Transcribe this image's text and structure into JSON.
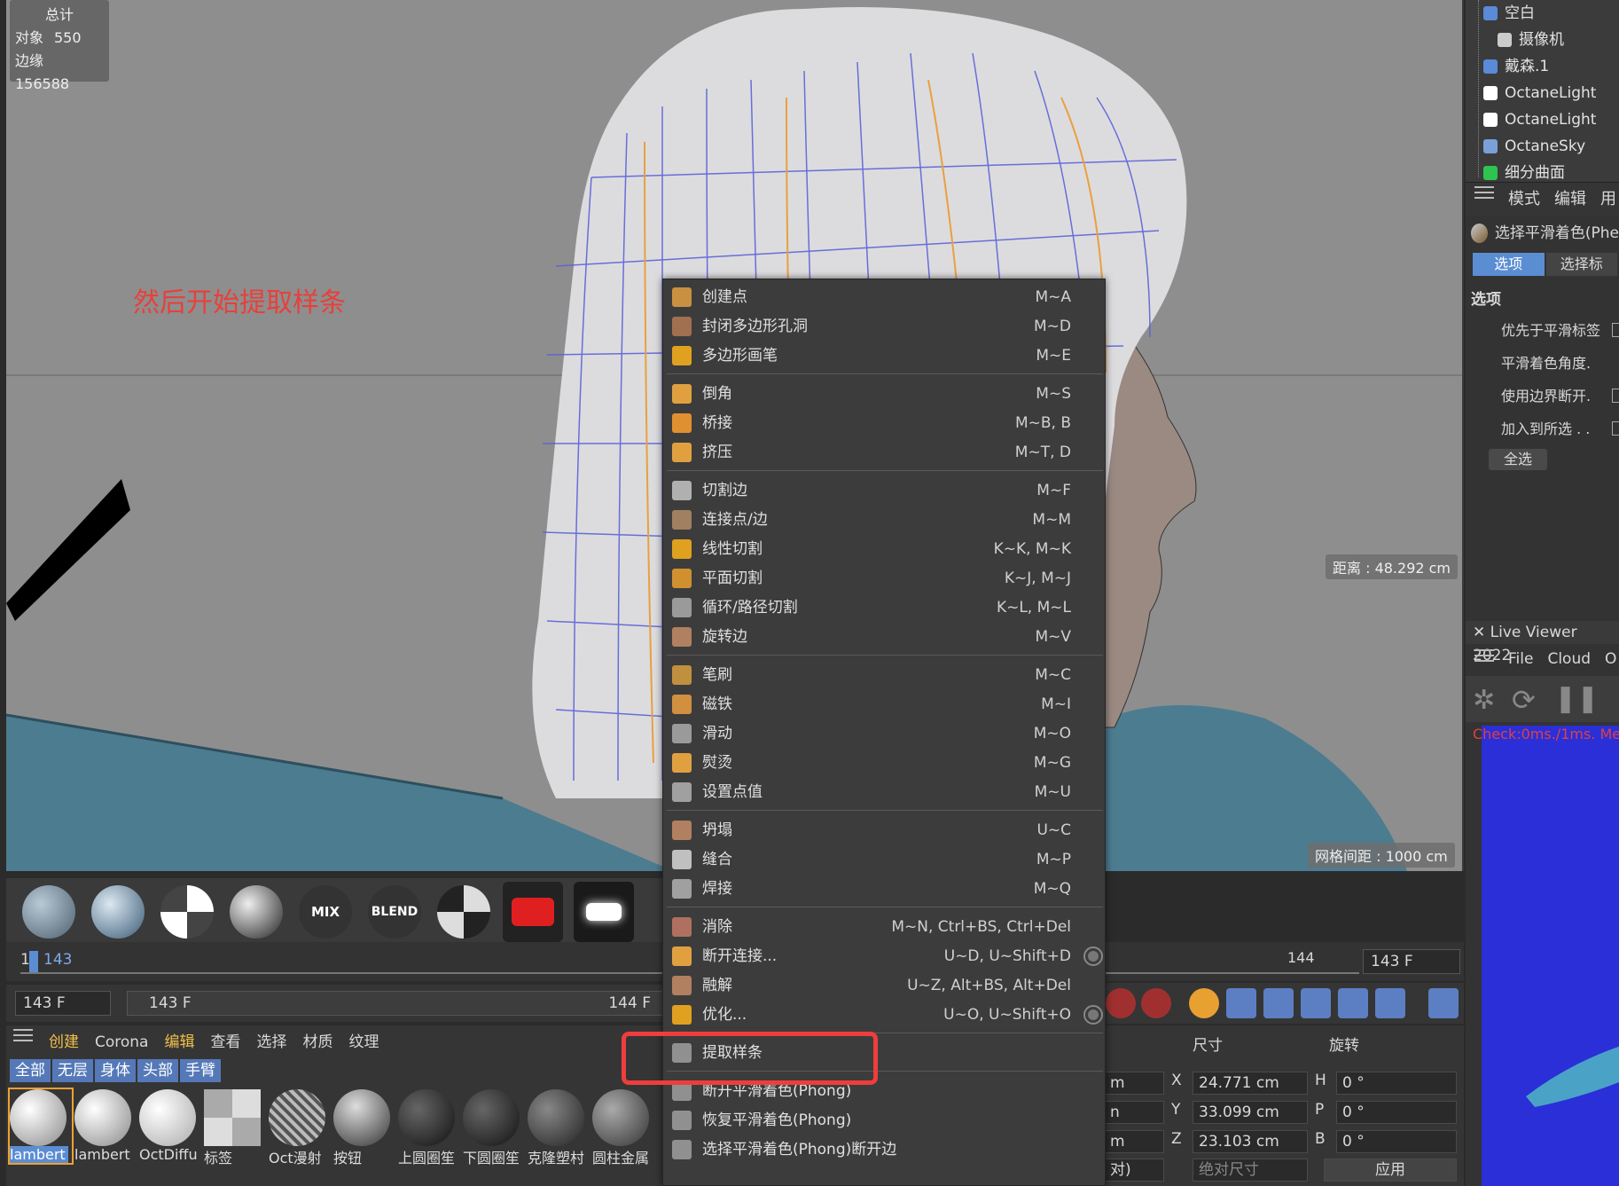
{
  "hud": {
    "title": "总计",
    "objects_label": "对象",
    "objects_value": "550",
    "edges_label": "边缘",
    "edges_value": "156588"
  },
  "annotation": "然后开始提取样条",
  "distance_label": "距离 : 48.292 cm",
  "grid_label": "网格间距 : 1000 cm",
  "objects": [
    {
      "label": "空白",
      "icon": "null-icon"
    },
    {
      "label": "摄像机",
      "icon": "camera-icon"
    },
    {
      "label": "戴森.1",
      "icon": "null-icon"
    },
    {
      "label": "OctaneLight",
      "icon": "light-icon"
    },
    {
      "label": "OctaneLight",
      "icon": "light-icon"
    },
    {
      "label": "OctaneSky",
      "icon": "sky-icon"
    },
    {
      "label": "细分曲面",
      "icon": "subdivision-icon"
    }
  ],
  "attr_menu": [
    "模式",
    "编辑",
    "用"
  ],
  "attr_title": "选择平滑着色(Phe",
  "attr_tabs": [
    "选项",
    "选择标"
  ],
  "attr_section": "选项",
  "attr_options": [
    "优先于平滑标签",
    "平滑着色角度.",
    "使用边界断开.",
    "加入到所选 . ."
  ],
  "attr_button": "全选",
  "live_viewer": {
    "title": "Live Viewer 2022",
    "menu": [
      "File",
      "Cloud",
      "O"
    ],
    "check": "Check:0ms./1ms. Me"
  },
  "matbar": [
    "MIX",
    "BLEND"
  ],
  "timeline": {
    "start": "1",
    "current": "143",
    "tick": "144",
    "frame_field": "143 F"
  },
  "frames": {
    "left": "143 F",
    "mid": "143 F",
    "right": "144 F"
  },
  "matmgr": {
    "menu": [
      "创建",
      "Corona",
      "编辑",
      "查看",
      "选择",
      "材质",
      "纹理"
    ],
    "filters": [
      "全部",
      "无层",
      "身体",
      "头部",
      "手臂"
    ],
    "materials": [
      "lambert",
      "lambert",
      "OctDiffu",
      "标签",
      "Oct漫射",
      "按钮",
      "上圆圈笙",
      "下圆圈笙",
      "克隆塑村",
      "圆柱金属"
    ]
  },
  "coords": {
    "size_header": "尺寸",
    "rot_header": "旋转",
    "rows": [
      {
        "pos": "m",
        "axis": "X",
        "size": "24.771 cm",
        "raxis": "H",
        "rot": "0 °"
      },
      {
        "pos": "n",
        "axis": "Y",
        "size": "33.099 cm",
        "raxis": "P",
        "rot": "0 °"
      },
      {
        "pos": "m",
        "axis": "Z",
        "size": "23.103 cm",
        "raxis": "B",
        "rot": "0 °"
      }
    ],
    "mode_left": "对)",
    "mode_right": "绝对尺寸",
    "apply": "应用"
  },
  "context_menu": [
    {
      "label": "创建点",
      "shortcut": "M~A"
    },
    {
      "label": "封闭多边形孔洞",
      "shortcut": "M~D"
    },
    {
      "label": "多边形画笔",
      "shortcut": "M~E"
    },
    {
      "label": "倒角",
      "shortcut": "M~S"
    },
    {
      "label": "桥接",
      "shortcut": "M~B, B"
    },
    {
      "label": "挤压",
      "shortcut": "M~T, D"
    },
    {
      "label": "切割边",
      "shortcut": "M~F"
    },
    {
      "label": "连接点/边",
      "shortcut": "M~M"
    },
    {
      "label": "线性切割",
      "shortcut": "K~K, M~K"
    },
    {
      "label": "平面切割",
      "shortcut": "K~J, M~J"
    },
    {
      "label": "循环/路径切割",
      "shortcut": "K~L, M~L"
    },
    {
      "label": "旋转边",
      "shortcut": "M~V"
    },
    {
      "label": "笔刷",
      "shortcut": "M~C"
    },
    {
      "label": "磁铁",
      "shortcut": "M~I"
    },
    {
      "label": "滑动",
      "shortcut": "M~O"
    },
    {
      "label": "熨烫",
      "shortcut": "M~G"
    },
    {
      "label": "设置点值",
      "shortcut": "M~U"
    },
    {
      "label": "坍塌",
      "shortcut": "U~C"
    },
    {
      "label": "缝合",
      "shortcut": "M~P"
    },
    {
      "label": "焊接",
      "shortcut": "M~Q"
    },
    {
      "label": "消除",
      "shortcut": "M~N, Ctrl+BS, Ctrl+Del"
    },
    {
      "label": "断开连接...",
      "shortcut": "U~D, U~Shift+D"
    },
    {
      "label": "融解",
      "shortcut": "U~Z, Alt+BS, Alt+Del"
    },
    {
      "label": "优化...",
      "shortcut": "U~O, U~Shift+O"
    },
    {
      "label": "提取样条",
      "shortcut": ""
    },
    {
      "label": "断开平滑着色(Phong)",
      "shortcut": ""
    },
    {
      "label": "恢复平滑着色(Phong)",
      "shortcut": ""
    },
    {
      "label": "选择平滑着色(Phong)断开边",
      "shortcut": ""
    }
  ],
  "colors": {
    "accent": "#5b8dd3",
    "highlight": "#ef3d3d",
    "annotation": "#e8403a"
  }
}
